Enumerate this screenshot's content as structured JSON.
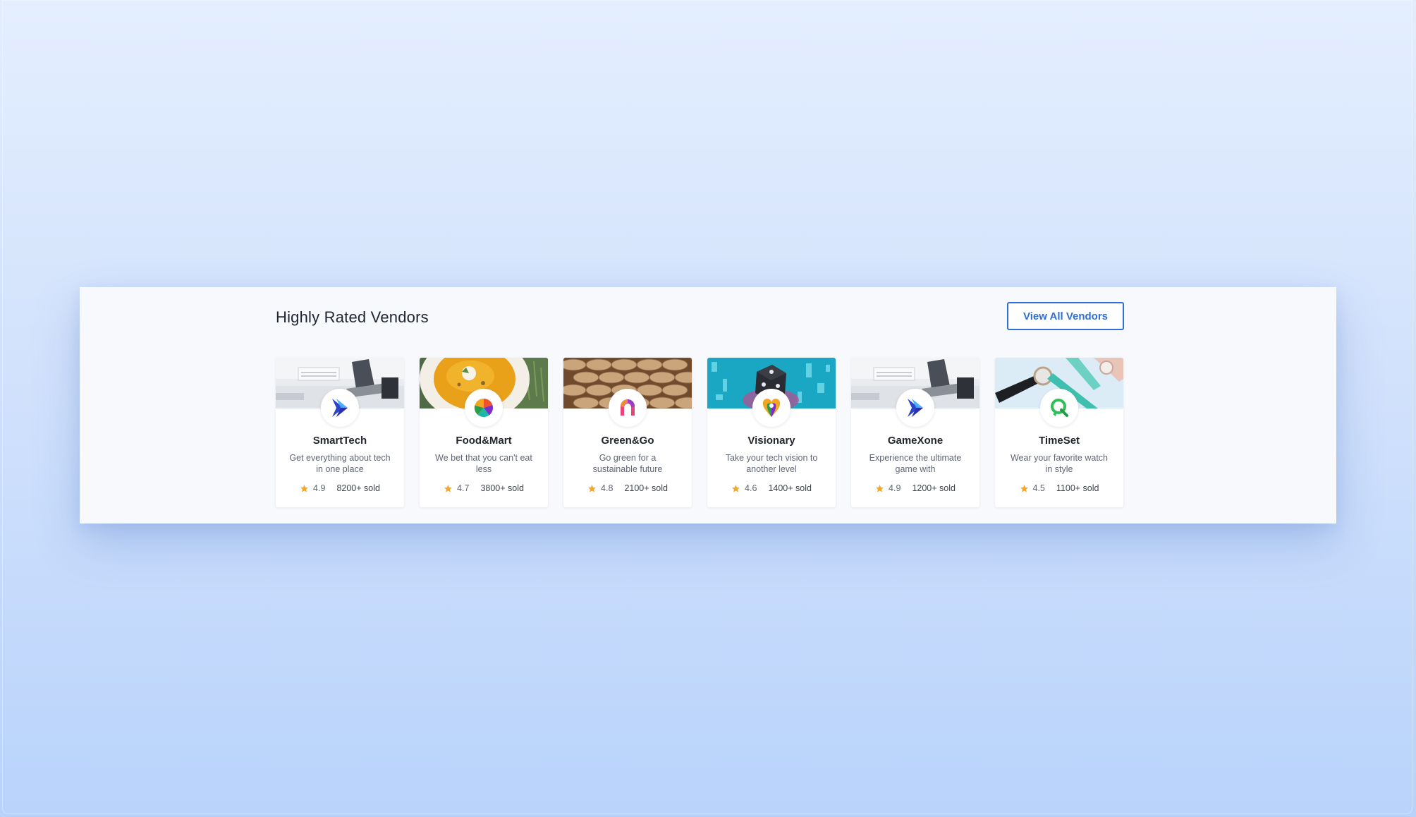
{
  "section": {
    "title": "Highly Rated Vendors",
    "view_all_label": "View All Vendors"
  },
  "colors": {
    "accent": "#2f6fd6",
    "star": "#f5a623",
    "panel_bg": "#f7f9fc"
  },
  "vendors": [
    {
      "name": "SmartTech",
      "description": "Get everything about tech in one place",
      "rating": "4.9",
      "sold": "8200+ sold",
      "logo_icon": "chevron-logo-icon",
      "banner": "desk-laptop-banner"
    },
    {
      "name": "Food&Mart",
      "description": "We bet that you can't eat less",
      "rating": "4.7",
      "sold": "3800+ sold",
      "logo_icon": "color-wheel-logo-icon",
      "banner": "soup-bowl-banner"
    },
    {
      "name": "Green&Go",
      "description": "Go green for a sustainable future",
      "rating": "4.8",
      "sold": "2100+ sold",
      "logo_icon": "arch-logo-icon",
      "banner": "woven-basket-banner"
    },
    {
      "name": "Visionary",
      "description": "Take your tech vision to another level",
      "rating": "4.6",
      "sold": "1400+ sold",
      "logo_icon": "heart-pin-logo-icon",
      "banner": "dice-neon-banner"
    },
    {
      "name": "GameXone",
      "description": "Experience the ultimate game with",
      "rating": "4.9",
      "sold": "1200+ sold",
      "logo_icon": "chevron-logo-icon",
      "banner": "desk-laptop-banner"
    },
    {
      "name": "TimeSet",
      "description": "Wear your favorite watch in style",
      "rating": "4.5",
      "sold": "1100+ sold",
      "logo_icon": "chat-bubble-logo-icon",
      "banner": "watches-banner"
    }
  ]
}
